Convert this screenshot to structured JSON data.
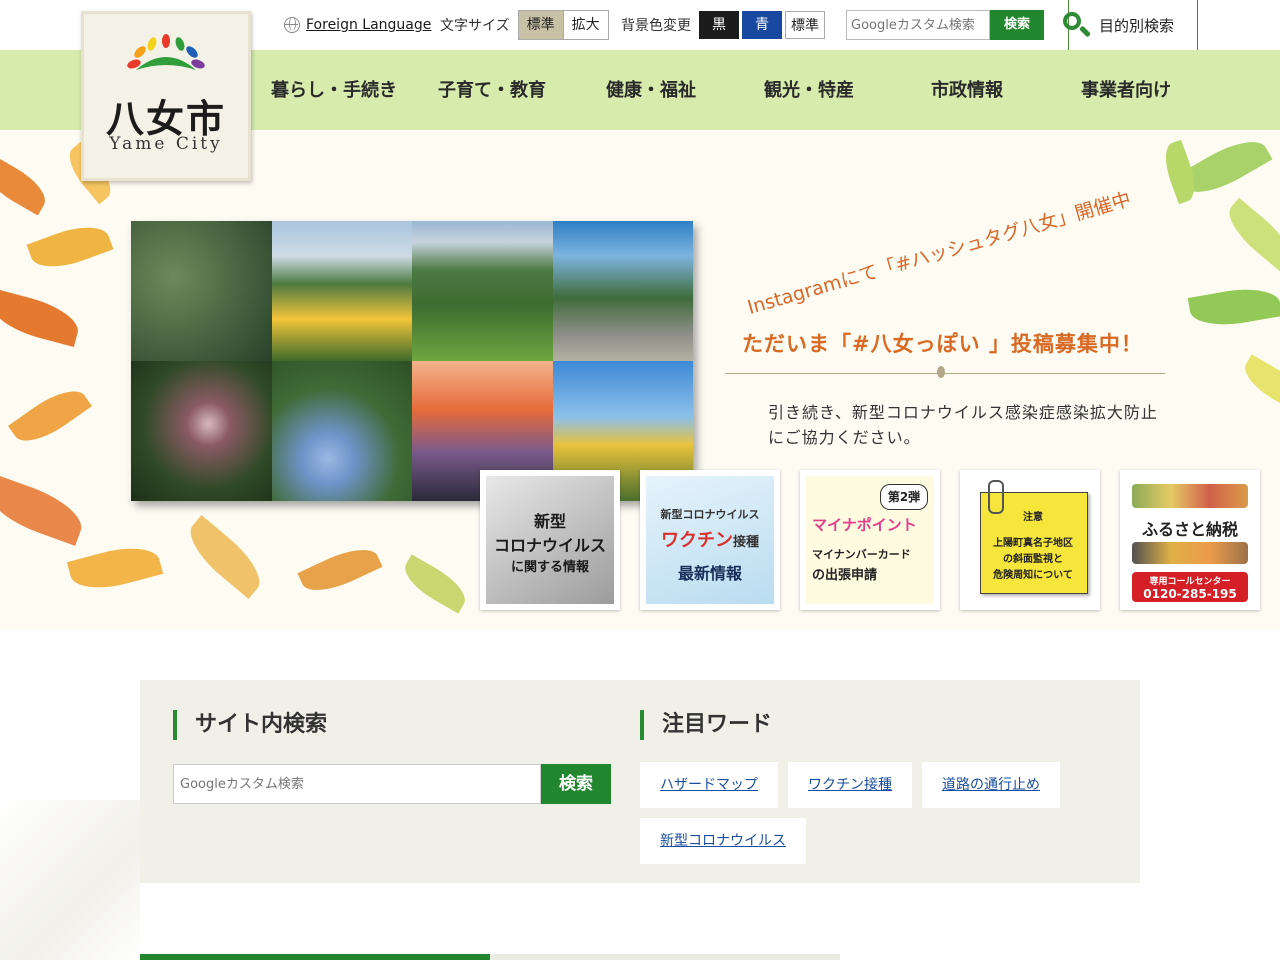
{
  "header": {
    "foreign_language": "Foreign Language",
    "font_size_label": "文字サイズ",
    "font_size_standard": "標準",
    "font_size_large": "拡大",
    "bg_color_label": "背景色変更",
    "bg_black": "黒",
    "bg_blue": "青",
    "bg_standard": "標準",
    "search_placeholder": "Googleカスタム検索",
    "search_button": "検索",
    "purpose_search": "目的別検索"
  },
  "logo": {
    "name_ja": "八女市",
    "name_en": "Yame City",
    "colors": [
      "#e8392a",
      "#f5a017",
      "#f3d21a",
      "#2f9e3b",
      "#1f60b5",
      "#7c3d9c"
    ]
  },
  "nav": {
    "items": [
      {
        "label": "暮らし・手続き"
      },
      {
        "label": "子育て・教育"
      },
      {
        "label": "健康・福祉"
      },
      {
        "label": "観光・特産"
      },
      {
        "label": "市政情報"
      },
      {
        "label": "事業者向け"
      }
    ]
  },
  "hero": {
    "instagram_line": "Instagramにて「#ハッシュタグ八女」開催中",
    "campaign_line": "ただいま「#八女っぽい 」投稿募集中！",
    "notice": "引き続き、新型コロナウイルス感染症感染拡大防止にご協力ください。",
    "banners": [
      {
        "line1": "新型",
        "line2": "コロナウイルス",
        "line3": "に関する情報"
      },
      {
        "line1": "新型コロナウイルス",
        "line2": "ワクチン",
        "line2b": "接種",
        "line3": "最新情報"
      },
      {
        "tag": "第2弾",
        "title": "マイナポイント",
        "line1": "マイナンバーカード",
        "line2": "の出張申請"
      },
      {
        "tag": "注意",
        "line1": "上陽町真名子地区",
        "line2": "の斜面監視と",
        "line3": "危険周知について"
      },
      {
        "title": "ふるさと納税",
        "line1": "専用コールセンター",
        "line2": "0120-285-195"
      }
    ]
  },
  "site_search": {
    "heading": "サイト内検索",
    "placeholder": "Googleカスタム検索",
    "button": "検索"
  },
  "keywords": {
    "heading": "注目ワード",
    "items": [
      "ハザードマップ",
      "ワクチン接種",
      "道路の通行止め",
      "新型コロナウイルス"
    ]
  }
}
